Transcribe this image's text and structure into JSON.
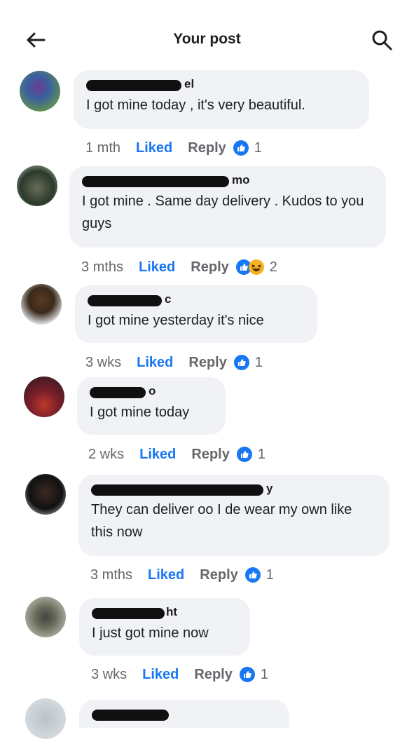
{
  "header": {
    "title": "Your post"
  },
  "comments": [
    {
      "name_tail": "el",
      "text": "I got mine today , it's very beautiful.",
      "time": "1 mth",
      "liked": "Liked",
      "reply": "Reply",
      "reactions": [
        "like"
      ],
      "count": "1"
    },
    {
      "name_tail": "mo",
      "text": "I got mine . Same day delivery . Kudos to you guys",
      "time": "3 mths",
      "liked": "Liked",
      "reply": "Reply",
      "reactions": [
        "like",
        "haha"
      ],
      "count": "2"
    },
    {
      "name_tail": "c",
      "text": "I got mine yesterday it's nice",
      "time": "3 wks",
      "liked": "Liked",
      "reply": "Reply",
      "reactions": [
        "like"
      ],
      "count": "1"
    },
    {
      "name_tail": "o",
      "text": "I got mine today",
      "time": "2 wks",
      "liked": "Liked",
      "reply": "Reply",
      "reactions": [
        "like"
      ],
      "count": "1"
    },
    {
      "name_tail": "y",
      "text": "They can deliver oo I de wear my own like this now",
      "time": "3 mths",
      "liked": "Liked",
      "reply": "Reply",
      "reactions": [
        "like"
      ],
      "count": "1"
    },
    {
      "name_tail": "ht",
      "text": "I just got mine now",
      "time": "3 wks",
      "liked": "Liked",
      "reply": "Reply",
      "reactions": [
        "like"
      ],
      "count": "1"
    }
  ],
  "colors": {
    "accent": "#1877f2",
    "bubble": "#f0f2f5",
    "muted": "#65676b"
  }
}
